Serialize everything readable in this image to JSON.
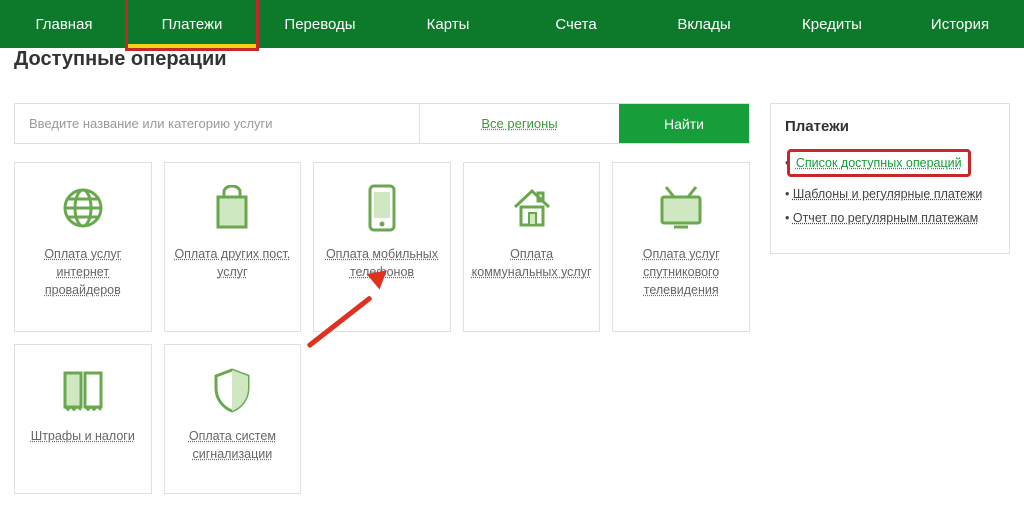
{
  "nav": {
    "items": [
      "Главная",
      "Платежи",
      "Переводы",
      "Карты",
      "Счета",
      "Вклады",
      "Кредиты",
      "История"
    ],
    "active_index": 1
  },
  "page_title": "Доступные операции",
  "search": {
    "placeholder": "Введите название или категорию услуги",
    "region_label": "Все регионы",
    "find_label": "Найти"
  },
  "cards": [
    {
      "label": "Оплата услуг интернет провайдеров",
      "icon": "globe"
    },
    {
      "label": "Оплата других пост. услуг",
      "icon": "bag"
    },
    {
      "label": "Оплата мобильных телефонов",
      "icon": "phone"
    },
    {
      "label": "Оплата коммунальных услуг",
      "icon": "house"
    },
    {
      "label": "Оплата услуг спутникового телевидения",
      "icon": "tv"
    },
    {
      "label": "Штрафы и налоги",
      "icon": "receipt"
    },
    {
      "label": "Оплата систем сигнализации",
      "icon": "shield"
    }
  ],
  "sidebar": {
    "title": "Платежи",
    "items": [
      "Список доступных операций",
      "Шаблоны и регулярные платежи",
      "Отчет по регулярным платежам"
    ]
  }
}
